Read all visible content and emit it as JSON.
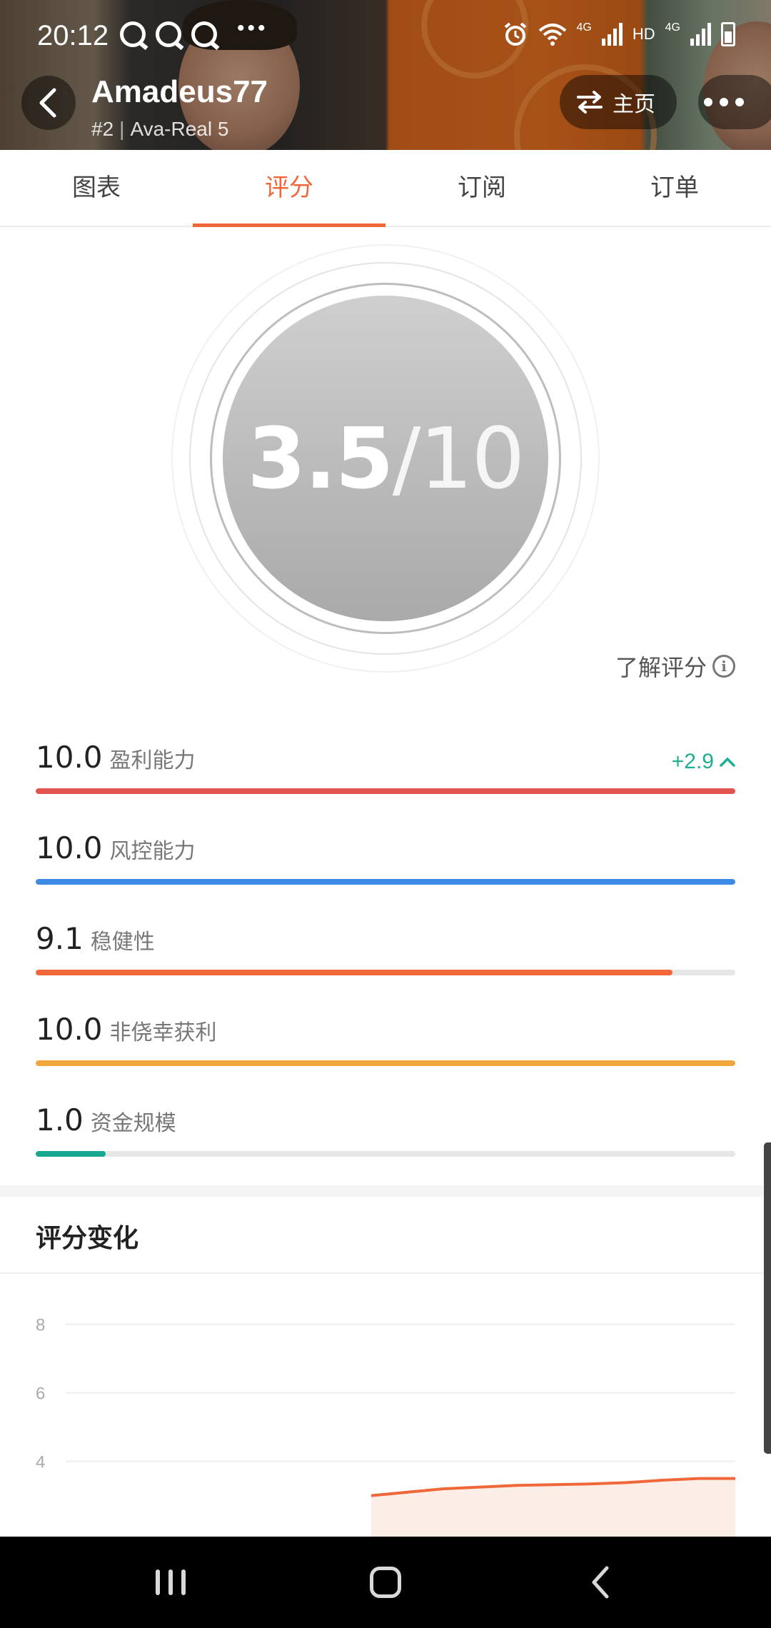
{
  "status_bar": {
    "time": "20:12",
    "notification_icons": [
      "qq-icon",
      "qq-icon",
      "qq-icon"
    ],
    "more_dots": "•••",
    "right_text_hd": "HD",
    "network_label_1": "4G",
    "network_label_2": "4G"
  },
  "header": {
    "trader_name": "Amadeus77",
    "rank": "#2",
    "account": "Ava-Real 5",
    "home_label": "主页"
  },
  "tabs": [
    {
      "label": "图表",
      "active": false
    },
    {
      "label": "评分",
      "active": true
    },
    {
      "label": "订阅",
      "active": false
    },
    {
      "label": "订单",
      "active": false
    }
  ],
  "score": {
    "value": "3.5",
    "total": "/10"
  },
  "learn_score_label": "了解评分",
  "metrics": [
    {
      "value": "10.0",
      "label": "盈利能力",
      "fraction": 1.0,
      "color": "#e0534f",
      "delta": "+2.9"
    },
    {
      "value": "10.0",
      "label": "风控能力",
      "fraction": 1.0,
      "color": "#3f8ae6"
    },
    {
      "value": "9.1",
      "label": "稳健性",
      "fraction": 0.91,
      "color": "#f0683a"
    },
    {
      "value": "10.0",
      "label": "非侥幸获利",
      "fraction": 1.0,
      "color": "#f0a83c"
    },
    {
      "value": "1.0",
      "label": "资金规模",
      "fraction": 0.1,
      "color": "#15a88e"
    }
  ],
  "delta_color": "#1fae92",
  "section": {
    "title": "评分变化"
  },
  "chart_data": {
    "type": "area",
    "title": "",
    "xlabel": "",
    "ylabel": "",
    "yticks": [
      "8",
      "6",
      "4"
    ],
    "ylim": [
      3.2,
      8.2
    ],
    "x": [
      0,
      1,
      2,
      3,
      4,
      5,
      6,
      7,
      8,
      9,
      10
    ],
    "series": [
      {
        "values": [
          3.0,
          3.1,
          3.2,
          3.25,
          3.3,
          3.32,
          3.34,
          3.38,
          3.45,
          3.5,
          3.5
        ],
        "color": "#f0683a"
      }
    ],
    "grid": true
  }
}
